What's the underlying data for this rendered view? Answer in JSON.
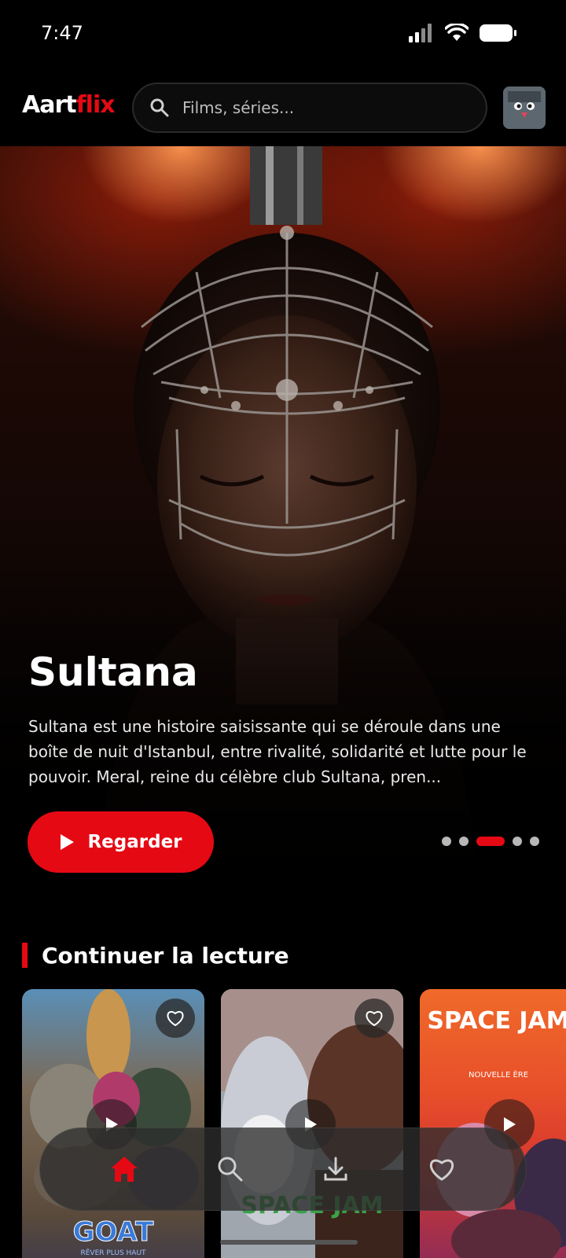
{
  "status_bar": {
    "time": "7:47"
  },
  "header": {
    "logo_part1": "Aart",
    "logo_part2": "flix",
    "search_placeholder": "Films, séries..."
  },
  "hero": {
    "title": "Sultana",
    "description": "Sultana est une histoire saisissante qui se déroule dans une boîte de nuit d'Istanbul, entre rivalité, solidarité et lutte pour le pouvoir. Meral, reine du célèbre club Sultana, pren...",
    "watch_label": "Regarder",
    "carousel_total": 5,
    "carousel_active": 3
  },
  "continue_section": {
    "title": "Continuer la lecture",
    "cards": [
      {
        "poster_text": "GOAT",
        "poster_subtext": "RÊVER PLUS HAUT"
      },
      {
        "poster_text": "SPACE JAM"
      },
      {
        "poster_text": "SPACE JAM",
        "poster_subtext": "NOUVELLE ÈRE"
      }
    ]
  },
  "bottom_nav": {
    "items": [
      "home-icon",
      "search-icon",
      "download-icon",
      "heart-icon"
    ],
    "active": "home-icon"
  },
  "colors": {
    "accent": "#e50914",
    "background": "#000000"
  }
}
